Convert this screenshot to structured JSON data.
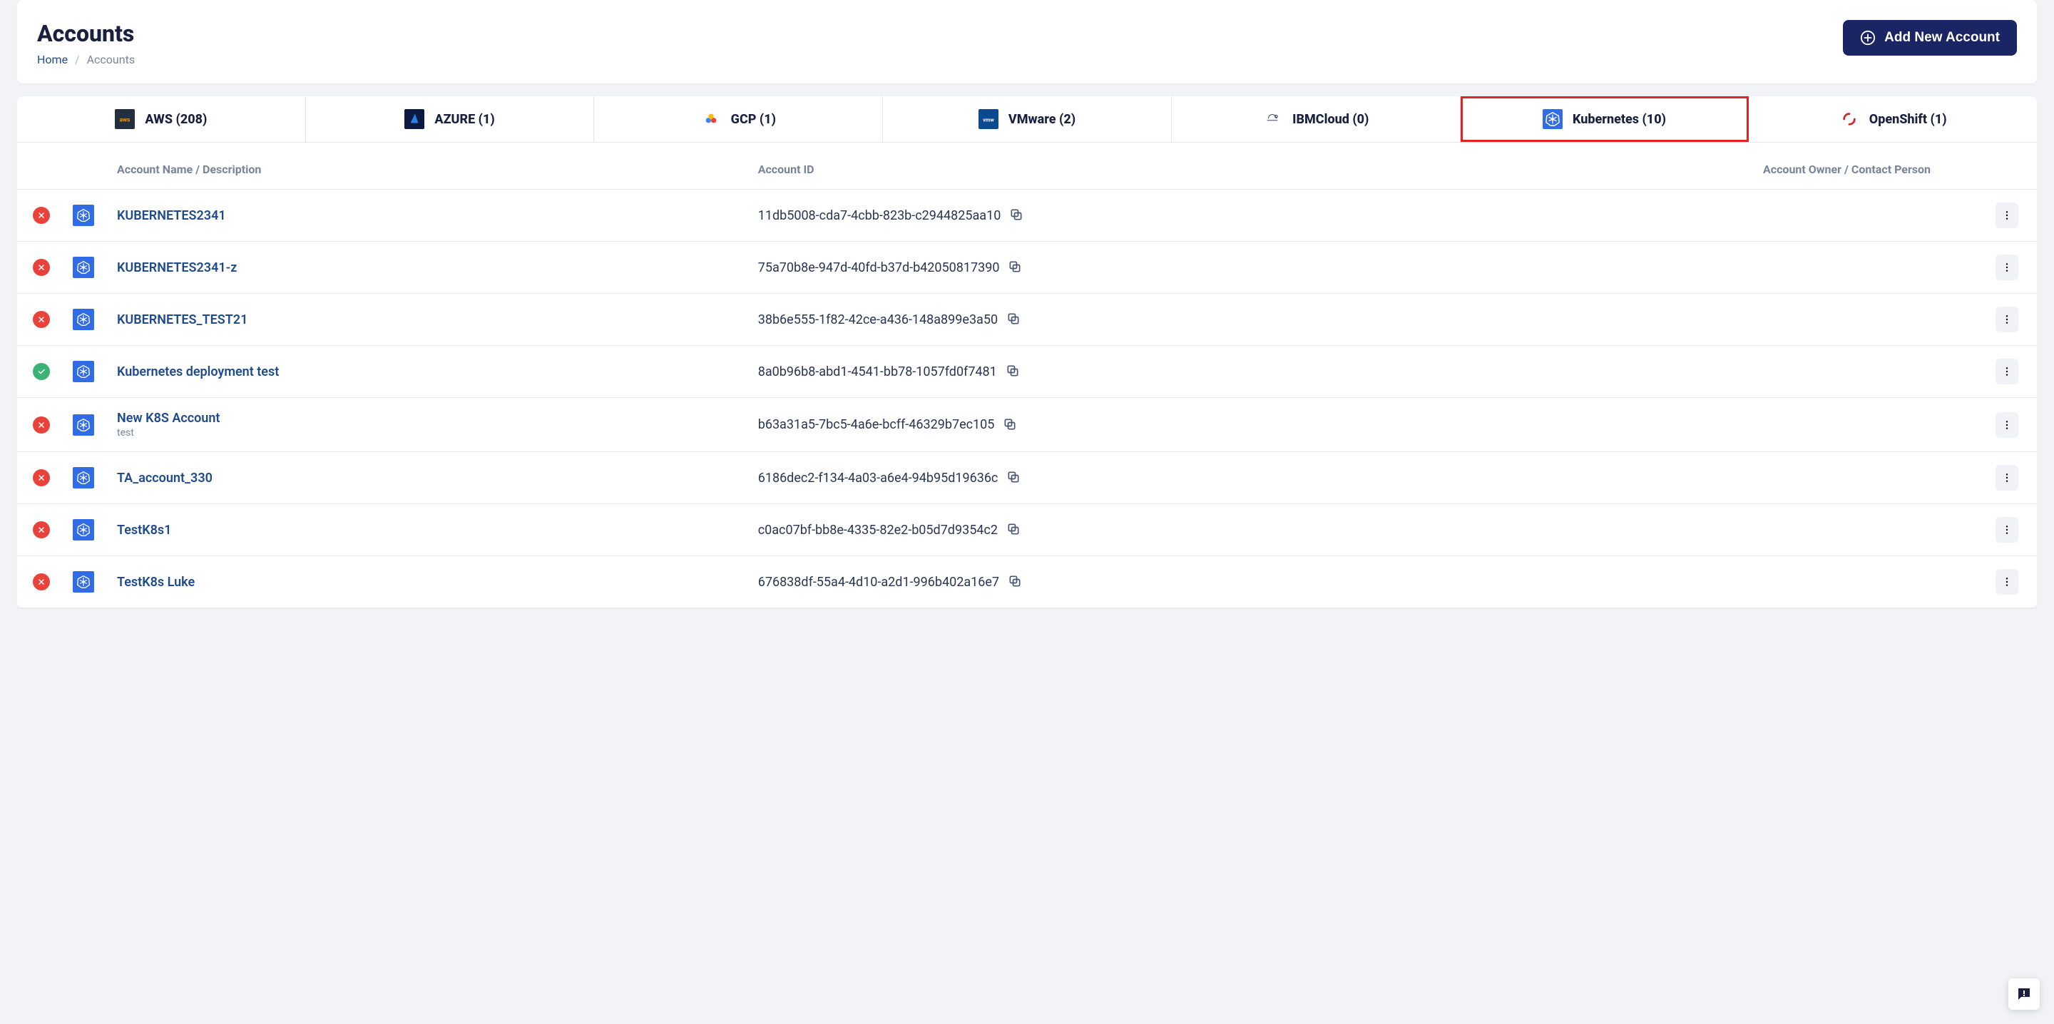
{
  "header": {
    "title": "Accounts",
    "breadcrumb": {
      "home": "Home",
      "current": "Accounts"
    },
    "add_button": "Add New Account"
  },
  "tabs": [
    {
      "key": "aws",
      "label": "AWS (208)",
      "icon": "aws",
      "selected": false
    },
    {
      "key": "azure",
      "label": "AZURE (1)",
      "icon": "azure",
      "selected": false
    },
    {
      "key": "gcp",
      "label": "GCP (1)",
      "icon": "gcp",
      "selected": false
    },
    {
      "key": "vmware",
      "label": "VMware (2)",
      "icon": "vmware",
      "selected": false
    },
    {
      "key": "ibm",
      "label": "IBMCloud (0)",
      "icon": "ibm",
      "selected": false
    },
    {
      "key": "k8s",
      "label": "Kubernetes (10)",
      "icon": "k8s",
      "selected": true
    },
    {
      "key": "openshift",
      "label": "OpenShift (1)",
      "icon": "openshift",
      "selected": false
    }
  ],
  "columns": {
    "name": "Account Name / Description",
    "id": "Account ID",
    "owner": "Account Owner / Contact Person"
  },
  "rows": [
    {
      "status": "error",
      "name": "KUBERNETES2341",
      "desc": "",
      "id": "11db5008-cda7-4cbb-823b-c2944825aa10",
      "owner": ""
    },
    {
      "status": "error",
      "name": "KUBERNETES2341-z",
      "desc": "",
      "id": "75a70b8e-947d-40fd-b37d-b42050817390",
      "owner": ""
    },
    {
      "status": "error",
      "name": "KUBERNETES_TEST21",
      "desc": "",
      "id": "38b6e555-1f82-42ce-a436-148a899e3a50",
      "owner": ""
    },
    {
      "status": "ok",
      "name": "Kubernetes deployment test",
      "desc": "",
      "id": "8a0b96b8-abd1-4541-bb78-1057fd0f7481",
      "owner": ""
    },
    {
      "status": "error",
      "name": "New K8S Account",
      "desc": "test",
      "id": "b63a31a5-7bc5-4a6e-bcff-46329b7ec105",
      "owner": ""
    },
    {
      "status": "error",
      "name": "TA_account_330",
      "desc": "",
      "id": "6186dec2-f134-4a03-a6e4-94b95d19636c",
      "owner": ""
    },
    {
      "status": "error",
      "name": "TestK8s1",
      "desc": "",
      "id": "c0ac07bf-bb8e-4335-82e2-b05d7d9354c2",
      "owner": ""
    },
    {
      "status": "error",
      "name": "TestK8s Luke",
      "desc": "",
      "id": "676838df-55a4-4d10-a2d1-996b402a16e7",
      "owner": ""
    }
  ]
}
